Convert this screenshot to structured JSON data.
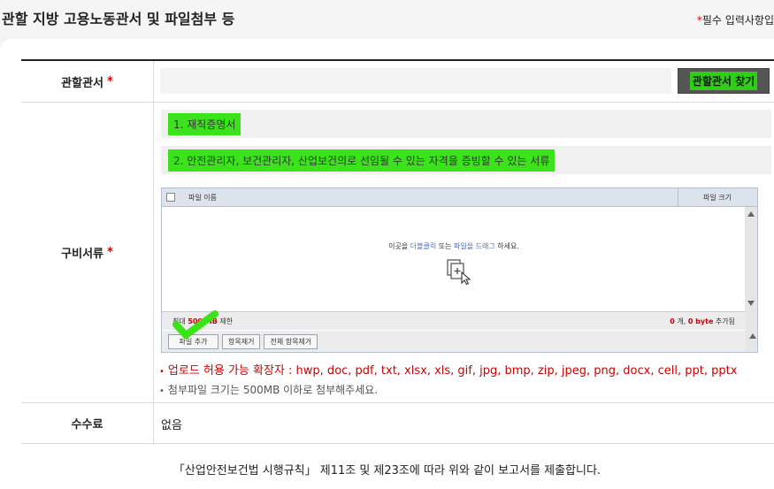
{
  "header": {
    "title": "관할 지방 고용노동관서 및 파일첨부 등",
    "required_star": "*",
    "required_note": "필수 입력사항입"
  },
  "form": {
    "office": {
      "label": "관할관서",
      "star": "*",
      "input_value": "",
      "button": "관할관서 찾기"
    },
    "documents": {
      "label": "구비서류",
      "star": "*",
      "items": [
        "1. 재직증명서",
        "2. 안전관리자, 보건관리자, 산업보건의로 선임될 수 있는 자격을 증빙할 수 있는 서류"
      ]
    },
    "uploader": {
      "col_name": "파일 이름",
      "col_size": "파일 크기",
      "drop_prefix": "이곳을 ",
      "drop_link1": "더블클릭",
      "drop_mid": " 또는 ",
      "drop_link2": "파일을 드래그",
      "drop_suffix": " 하세요.",
      "limit_prefix": "최대 ",
      "limit_value": "500 MB",
      "limit_suffix": " 제한",
      "count_files": "0",
      "count_mid": " 개, ",
      "count_bytes": "0 byte",
      "count_suffix": " 추가됨",
      "btn_add": "파일 추가",
      "btn_remove": "항목제거",
      "btn_remove_all": "전체 항목제거"
    },
    "notes": {
      "bullet": "•",
      "extensions": "업로드 허용 가능 확장자 : hwp, doc, pdf, txt, xlsx, xls, gif, jpg, bmp, zip, jpeg, png, docx, cell, ppt, pptx",
      "size_limit": "첨부파일 크기는 500MB 이하로 첨부해주세요."
    },
    "fee": {
      "label": "수수료",
      "value": "없음"
    }
  },
  "footer": {
    "statement": "「산업안전보건법 시행규칙」 제11조 및 제23조에 따라 위와 같이 보고서를 제출합니다."
  },
  "colors": {
    "highlight": "#3be31b",
    "required": "#dd0000",
    "button_dark": "#555555"
  }
}
